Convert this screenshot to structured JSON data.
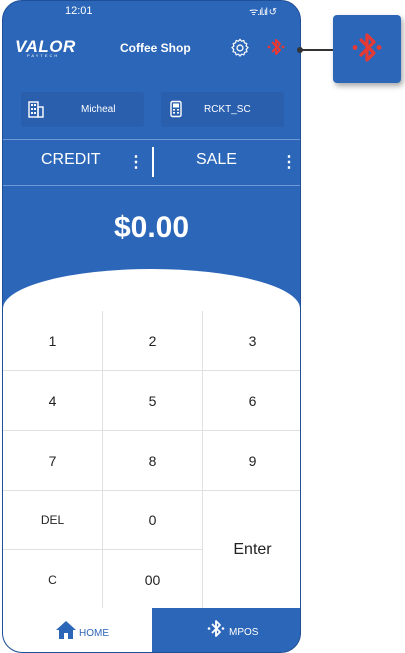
{
  "status": {
    "time": "12:01",
    "signal": "ᯤ.ıl.ıl ↺"
  },
  "header": {
    "logo": "VALOR",
    "logo_sub": "PAYTECH",
    "shop_name": "Coffee Shop"
  },
  "info": {
    "merchant": "Micheal",
    "device": "RCKT_SC"
  },
  "mode": {
    "left": "CREDIT",
    "right": "SALE",
    "menu_glyph": "⋮"
  },
  "amount": "$0.00",
  "keypad": {
    "k1": "1",
    "k2": "2",
    "k3": "3",
    "k4": "4",
    "k5": "5",
    "k6": "6",
    "k7": "7",
    "k8": "8",
    "k9": "9",
    "del": "DEL",
    "k0": "0",
    "clear": "C",
    "k00": "00",
    "enter": "Enter"
  },
  "nav": {
    "home": "HOME",
    "mpos": "MPOS"
  },
  "colors": {
    "primary": "#2c66b8",
    "bluetooth_alert": "#e53935"
  },
  "icons": {
    "gear": "gear-icon",
    "bluetooth": "bluetooth-icon",
    "merchant": "building-icon",
    "device": "terminal-icon",
    "home": "home-icon"
  }
}
